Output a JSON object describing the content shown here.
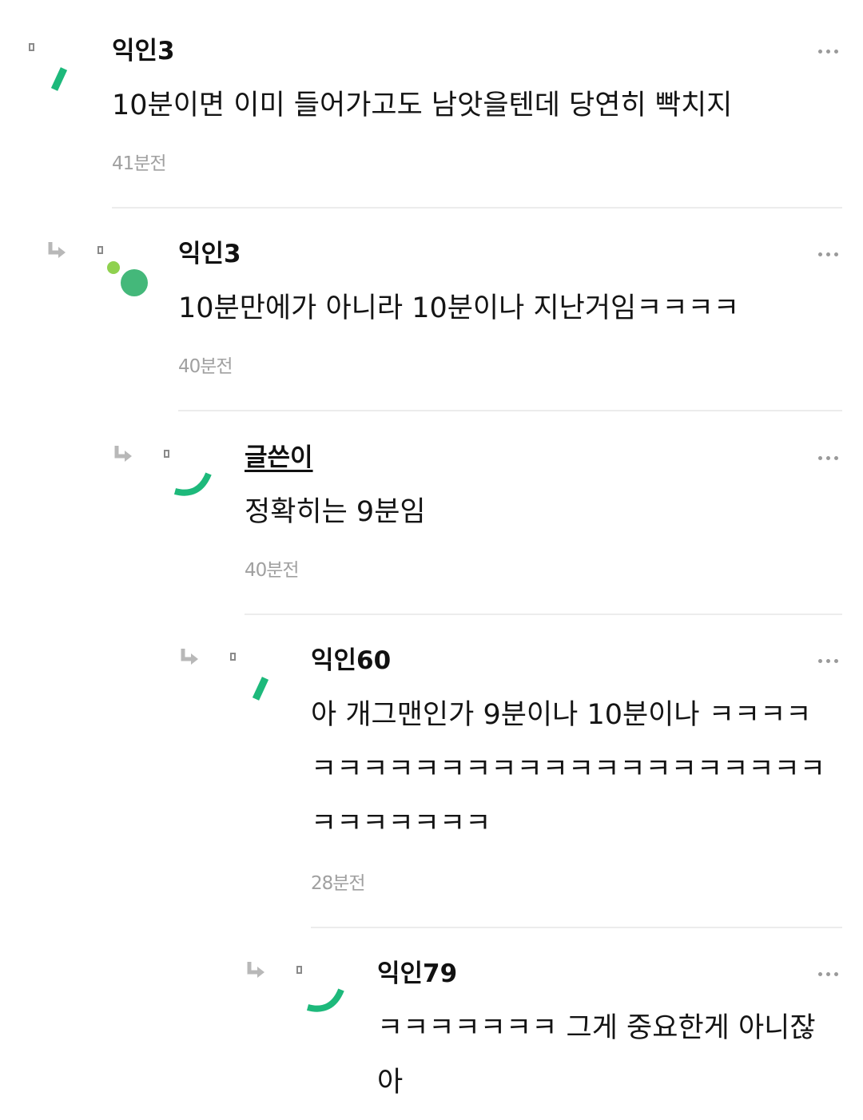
{
  "colors": {
    "accent_green": "#1db97b",
    "light_green": "#8fd14f",
    "muted_text": "#a0a0a0",
    "icon_gray": "#b8b8b8"
  },
  "comments": [
    {
      "author": "익인3",
      "body": "10분이면 이미 들어가고도 남앗을텐데 당연히 빡치지",
      "time": "41분전",
      "is_reply": false,
      "is_op": false,
      "avatar_icon": "green-slash-avatar-icon"
    },
    {
      "author": "익인3",
      "body": "10분만에가 아니라 10분이나 지난거임ㅋㅋㅋㅋ",
      "time": "40분전",
      "is_reply": true,
      "is_op": false,
      "avatar_icon": "green-dots-avatar-icon"
    },
    {
      "author": "글쓴이",
      "body": "정확히는 9분임",
      "time": "40분전",
      "is_reply": true,
      "is_op": true,
      "avatar_icon": "green-arc-avatar-icon"
    },
    {
      "author": "익인60",
      "body": "아 개그맨인가 9분이나 10분이나 ㅋㅋㅋㅋㅋㅋㅋㅋㅋㅋㅋㅋㅋㅋㅋㅋㅋㅋㅋㅋㅋㅋㅋㅋㅋㅋㅋㅋㅋㅋㅋ",
      "time": "28분전",
      "is_reply": true,
      "is_op": false,
      "avatar_icon": "green-slash-avatar-icon"
    },
    {
      "author": "익인79",
      "body": "ㅋㅋㅋㅋㅋㅋㅋ 그게 중요한게 아니잖아",
      "time": "",
      "is_reply": true,
      "is_op": false,
      "avatar_icon": "green-arc-avatar-icon"
    }
  ]
}
